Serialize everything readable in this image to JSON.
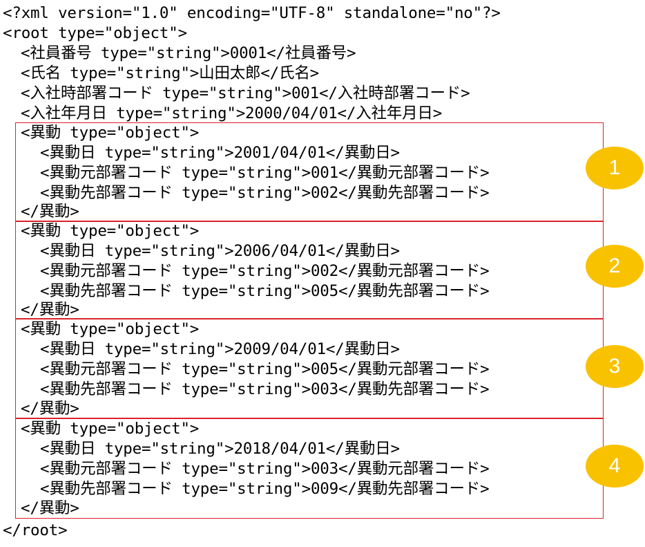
{
  "xml_declaration": "<?xml version=\"1.0\" encoding=\"UTF-8\" standalone=\"no\"?>",
  "root_open": "<root type=\"object\">",
  "root_close": "</root>",
  "fields": [
    "<社員番号 type=\"string\">0001</社員番号>",
    "<氏名 type=\"string\">山田太郎</氏名>",
    "<入社時部署コード type=\"string\">001</入社時部署コード>",
    "<入社年月日 type=\"string\">2000/04/01</入社年月日>"
  ],
  "transfers": [
    {
      "badge": "1",
      "open": "<異動 type=\"object\">",
      "date": "<異動日 type=\"string\">2001/04/01</異動日>",
      "from": "<異動元部署コード type=\"string\">001</異動元部署コード>",
      "to": "<異動先部署コード type=\"string\">002</異動先部署コード>",
      "close": "</異動>"
    },
    {
      "badge": "2",
      "open": "<異動 type=\"object\">",
      "date": "<異動日 type=\"string\">2006/04/01</異動日>",
      "from": "<異動元部署コード type=\"string\">002</異動元部署コード>",
      "to": "<異動先部署コード type=\"string\">005</異動先部署コード>",
      "close": "</異動>"
    },
    {
      "badge": "3",
      "open": "<異動 type=\"object\">",
      "date": "<異動日 type=\"string\">2009/04/01</異動日>",
      "from": "<異動元部署コード type=\"string\">005</異動元部署コード>",
      "to": "<異動先部署コード type=\"string\">003</異動先部署コード>",
      "close": "</異動>"
    },
    {
      "badge": "4",
      "open": "<異動 type=\"object\">",
      "date": "<異動日 type=\"string\">2018/04/01</異動日>",
      "from": "<異動元部署コード type=\"string\">003</異動元部署コード>",
      "to": "<異動先部署コード type=\"string\">009</異動先部署コード>",
      "close": "</異動>"
    }
  ],
  "colors": {
    "box_border": "#d9222a",
    "badge_fill": "#f9c200",
    "badge_text": "#ffffff"
  }
}
